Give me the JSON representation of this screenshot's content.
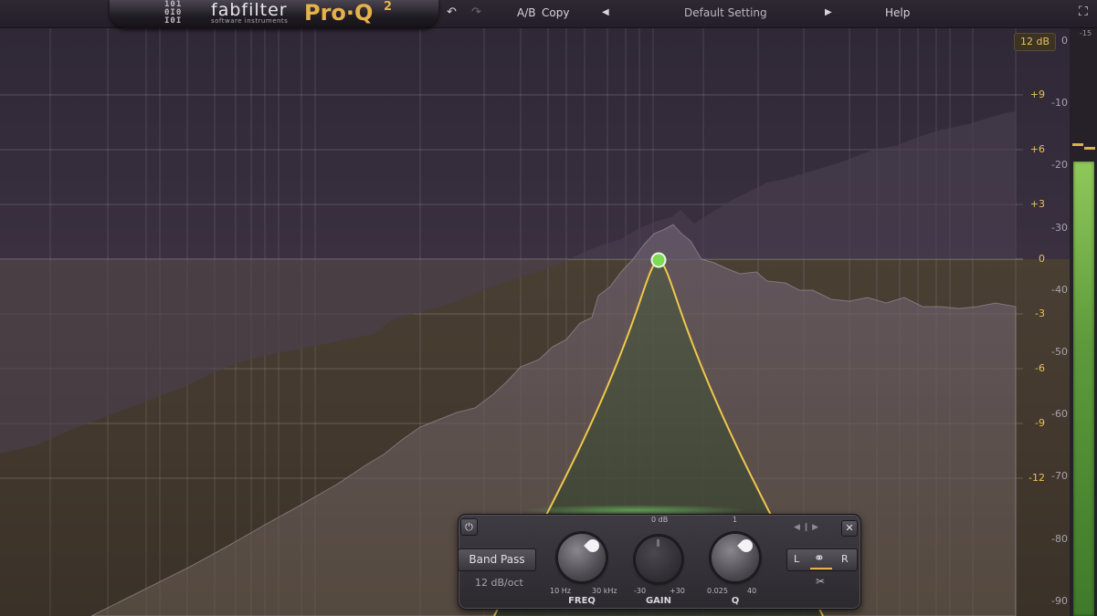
{
  "header": {
    "brand": "fabfilter",
    "tagline": "software instruments",
    "product": "Pro·Q",
    "product_version": "2",
    "ab_label": "A/B",
    "copy_label": "Copy",
    "preset_name": "Default Setting",
    "help_label": "Help"
  },
  "display": {
    "range_label": "12 dB",
    "eq_scale": [
      "+9",
      "+6",
      "+3",
      "0",
      "-3",
      "-6",
      "-9",
      "-12"
    ],
    "analyzer_scale": [
      "0",
      "-10",
      "-20",
      "-30",
      "-40",
      "-50",
      "-60",
      "-70",
      "-80",
      "-90"
    ],
    "meter_top": "-15"
  },
  "band": {
    "shape": "Band Pass",
    "slope": "12 dB/oct",
    "freq": {
      "label": "FREQ",
      "min": "10 Hz",
      "max": "30 kHz"
    },
    "gain": {
      "label": "GAIN",
      "min": "-30",
      "max": "+30",
      "top": "0 dB"
    },
    "q": {
      "label": "Q",
      "min": "0.025",
      "max": "40",
      "top": "1"
    },
    "channels": {
      "left": "L",
      "right": "R"
    }
  },
  "colors": {
    "accent": "#e6b24a",
    "curve": "#f0c84a",
    "node": "#7ed957",
    "meter": "#6fb24a"
  }
}
